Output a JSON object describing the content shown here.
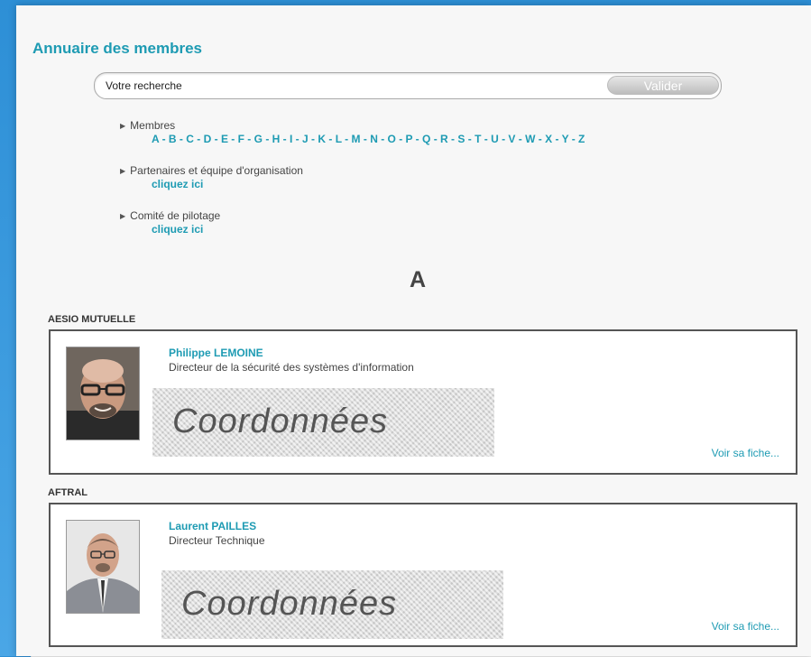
{
  "page": {
    "title": "Annuaire des membres"
  },
  "search": {
    "placeholder": "Votre recherche",
    "button": "Valider"
  },
  "categories": [
    {
      "label": "Membres"
    },
    {
      "label": "Partenaires et équipe d'organisation",
      "link": "cliquez ici"
    },
    {
      "label": "Comité de pilotage",
      "link": "cliquez ici"
    }
  ],
  "letters": [
    "A",
    "B",
    "C",
    "D",
    "E",
    "F",
    "G",
    "H",
    "I",
    "J",
    "K",
    "L",
    "M",
    "N",
    "O",
    "P",
    "Q",
    "R",
    "S",
    "T",
    "U",
    "V",
    "W",
    "X",
    "Y",
    "Z"
  ],
  "section_letter": "A",
  "members": [
    {
      "org": "AESIO MUTUELLE",
      "name": "Philippe LEMOINE",
      "role": "Directeur de la sécurité des systèmes d'information",
      "coordinates_label": "Coordonnées",
      "link": "Voir sa fiche..."
    },
    {
      "org": "AFTRAL",
      "name": "Laurent PAILLES",
      "role": "Directeur Technique",
      "coordinates_label": "Coordonnées",
      "link": "Voir sa fiche..."
    }
  ],
  "colors": {
    "accent": "#1e9bb3",
    "frame": "#2d8fd6",
    "card_border": "#555555"
  },
  "icons": [
    "triangle-right-icon"
  ]
}
